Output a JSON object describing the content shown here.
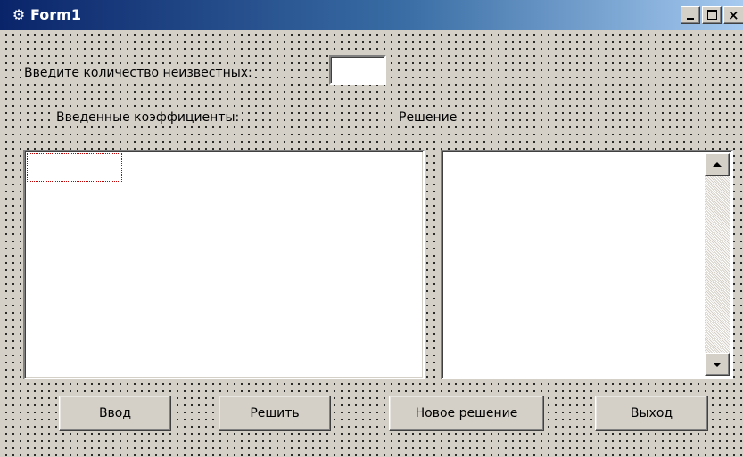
{
  "window": {
    "title": "Form1",
    "icon": "app-icon",
    "controls": {
      "minimize": "minimize-icon",
      "maximize": "maximize-icon",
      "close": "×"
    }
  },
  "form": {
    "unknowns_label": "Введите количество неизвестных:",
    "unknowns_value": "",
    "coefficients_label": "Введенные коэффициенты:",
    "solution_label": "Решение"
  },
  "buttons": {
    "input": "Ввод",
    "solve": "Решить",
    "new_solution": "Новое решение",
    "exit": "Выход"
  }
}
